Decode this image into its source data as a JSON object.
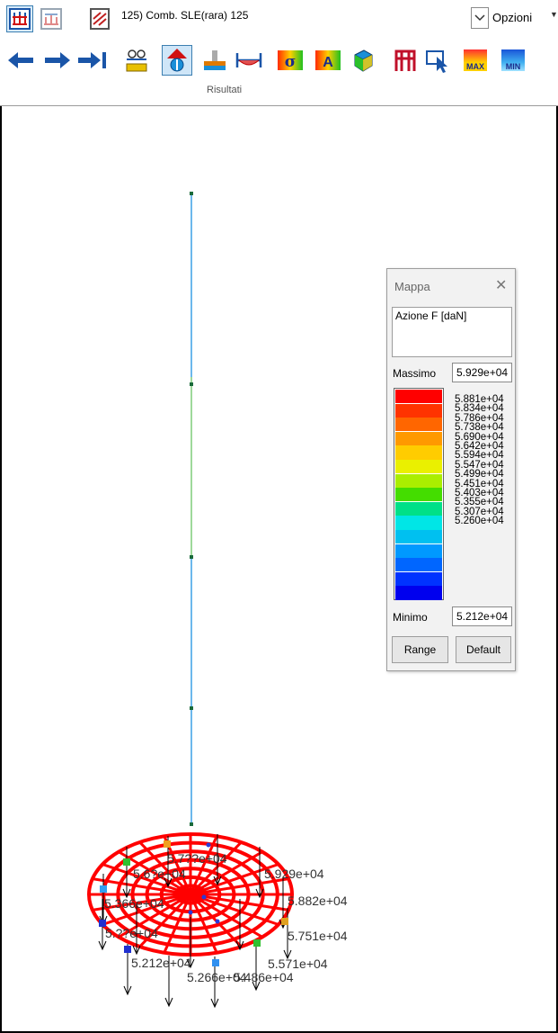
{
  "ribbon": {
    "combination_label": "125) Comb. SLE(rara)  125",
    "options_label": "Opzioni",
    "group_label": "Risultati",
    "mode_buttons": [
      "structure-view-icon",
      "loads-view-icon",
      "results-view-icon"
    ],
    "tools": [
      "arrow-left-icon",
      "arrow-right-icon",
      "arrow-step-right-icon",
      "reactions-icon",
      "deformed-shape-icon",
      "foundation-icon",
      "beam-diagram-icon",
      "sigma-stress-icon",
      "a-value-icon",
      "solid-view-icon",
      "frame-icon",
      "inspect-cursor-icon",
      "max-icon",
      "min-icon"
    ],
    "tool_text": {
      "sigma": "σ",
      "a": "A",
      "max": "MAX",
      "min": "MIN"
    }
  },
  "legend": {
    "title": "Mappa",
    "close_glyph": "✕",
    "description": "Azione F [daN]",
    "max_label": "Massimo",
    "max_value": "5.929e+04",
    "min_label": "Minimo",
    "min_value": "5.212e+04",
    "values": [
      "5.881e+04",
      "5.834e+04",
      "5.786e+04",
      "5.738e+04",
      "5.690e+04",
      "5.642e+04",
      "5.594e+04",
      "5.547e+04",
      "5.499e+04",
      "5.451e+04",
      "5.403e+04",
      "5.355e+04",
      "5.307e+04",
      "5.260e+04"
    ],
    "colors": [
      "#ff0000",
      "#ff3300",
      "#ff6600",
      "#ff9900",
      "#ffcc00",
      "#eaf000",
      "#aaee00",
      "#44dd00",
      "#00e088",
      "#00e6e6",
      "#00c0f0",
      "#0099ff",
      "#0066ff",
      "#0033ff",
      "#0000ee"
    ],
    "range_button": "Range",
    "default_button": "Default"
  },
  "model": {
    "mesh_color": "#ff0000",
    "column_color": "#3ba0e6",
    "labels": [
      "5.7??e+04",
      "5.929e+04",
      "5.6?e+04",
      "5.882e+04",
      "5.366e+04",
      "5.??e+04",
      "5.751e+04",
      "5.212e+04",
      "5.571e+04",
      "5.266e+04",
      "5.486e+04"
    ]
  }
}
